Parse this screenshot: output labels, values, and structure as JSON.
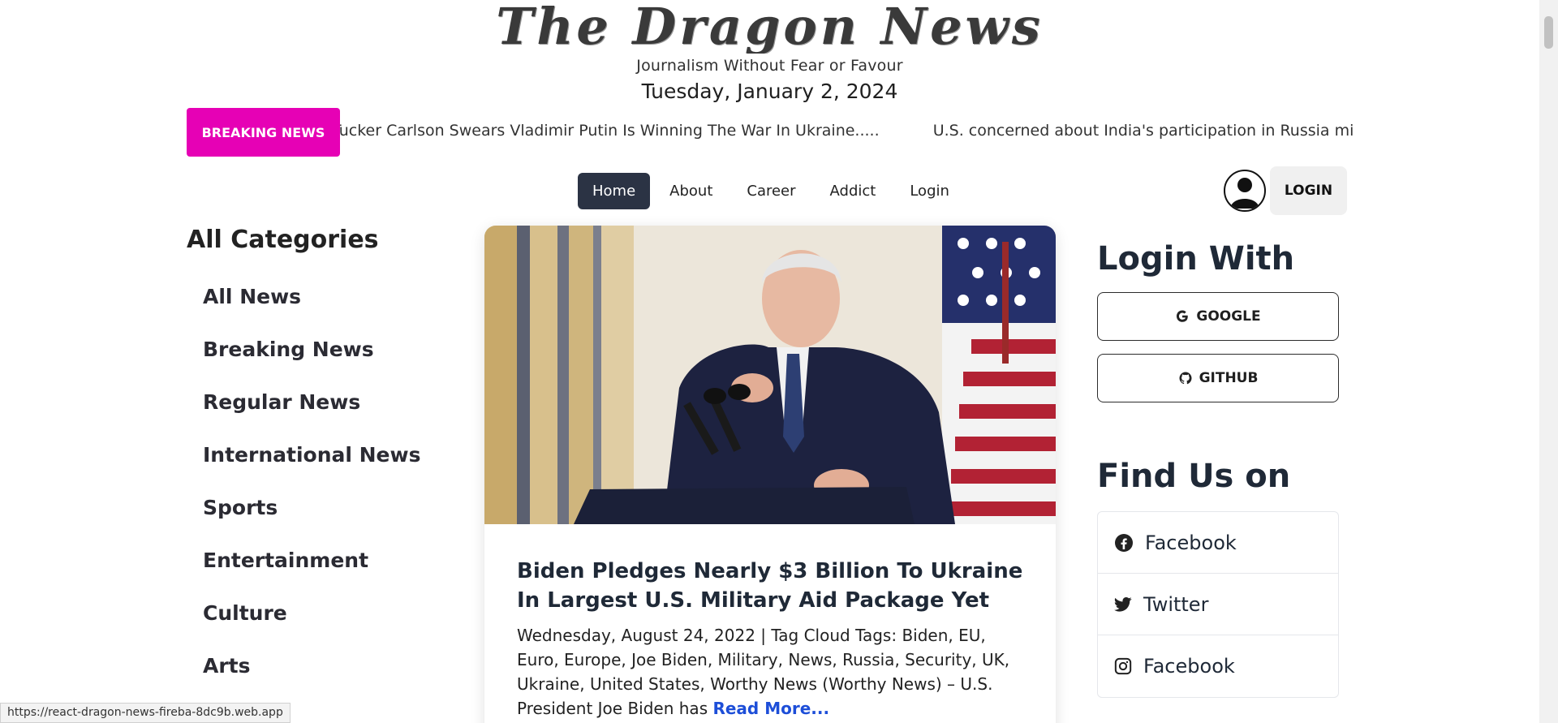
{
  "header": {
    "logo_text": "The Dragon News",
    "tagline": "Journalism Without Fear or Favour",
    "date": "Tuesday, January 2, 2024"
  },
  "ticker": {
    "button_label": "BREAKING NEWS",
    "items": [
      "Tucker Carlson Swears Vladimir Putin Is Winning The War In Ukraine.....",
      "U.S. concerned about India's participation in Russia military exercises"
    ]
  },
  "nav": {
    "links": [
      "Home",
      "About",
      "Career",
      "Addict",
      "Login"
    ],
    "active": "Home",
    "login_button": "LOGIN",
    "avatar_icon": "user-avatar-icon"
  },
  "categories": {
    "title": "All Categories",
    "items": [
      "All News",
      "Breaking News",
      "Regular News",
      "International News",
      "Sports",
      "Entertainment",
      "Culture",
      "Arts"
    ]
  },
  "article": {
    "title": "Biden Pledges Nearly $3 Billion To Ukraine In Largest U.S. Military Aid Package Yet",
    "meta": "Wednesday, August 24, 2022 | Tag Cloud Tags: Biden, EU, Euro, Europe, Joe Biden, Military, News, Russia, Security, UK, Ukraine, United States, Worthy News (Worthy News) – U.S. President Joe Biden has",
    "read_more": "Read More...",
    "image_icon": "biden-podium-photo"
  },
  "login_with": {
    "title": "Login With",
    "google": "GOOGLE",
    "github": "GITHUB"
  },
  "find_us": {
    "title": "Find Us on",
    "items": [
      {
        "label": "Facebook",
        "icon": "facebook-icon"
      },
      {
        "label": "Twitter",
        "icon": "twitter-icon"
      },
      {
        "label": "Facebook",
        "icon": "instagram-icon"
      }
    ]
  },
  "status_url": "https://react-dragon-news-fireba-8dc9b.web.app",
  "colors": {
    "breaking": "#e601b5",
    "nav_active": "#2b3344",
    "read_more": "#1d4ed8"
  }
}
